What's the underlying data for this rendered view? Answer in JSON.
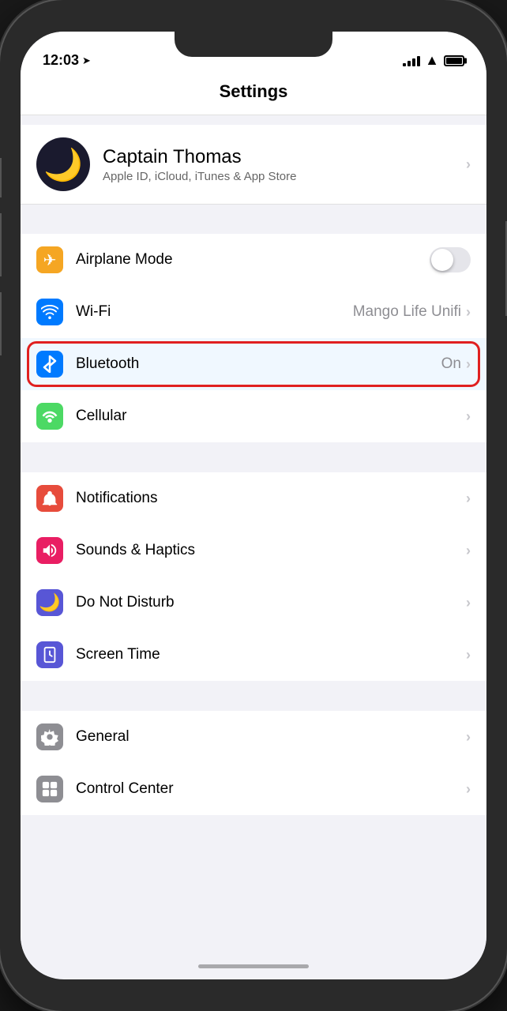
{
  "status_bar": {
    "time": "12:03",
    "has_location": true,
    "signal_bars": [
      3,
      5,
      7,
      10,
      12
    ],
    "battery_label": "battery"
  },
  "nav": {
    "title": "Settings"
  },
  "profile": {
    "name": "Captain Thomas",
    "subtitle": "Apple ID, iCloud, iTunes & App Store",
    "avatar_emoji": "🌙"
  },
  "settings_groups": [
    {
      "id": "connectivity",
      "items": [
        {
          "id": "airplane-mode",
          "icon_bg": "#f5a623",
          "icon": "✈",
          "label": "Airplane Mode",
          "value": "",
          "has_toggle": true,
          "toggle_on": false,
          "has_chevron": false
        },
        {
          "id": "wifi",
          "icon_bg": "#007aff",
          "icon": "📶",
          "label": "Wi-Fi",
          "value": "Mango Life Unifi",
          "has_toggle": false,
          "has_chevron": true
        },
        {
          "id": "bluetooth",
          "icon_bg": "#007aff",
          "icon": "Ⓑ",
          "label": "Bluetooth",
          "value": "On",
          "has_toggle": false,
          "has_chevron": true,
          "highlighted": true
        },
        {
          "id": "cellular",
          "icon_bg": "#4cd964",
          "icon": "📡",
          "label": "Cellular",
          "value": "",
          "has_toggle": false,
          "has_chevron": true
        }
      ]
    },
    {
      "id": "notifications-group",
      "items": [
        {
          "id": "notifications",
          "icon_bg": "#e74c3c",
          "icon": "🔔",
          "label": "Notifications",
          "value": "",
          "has_toggle": false,
          "has_chevron": true
        },
        {
          "id": "sounds-haptics",
          "icon_bg": "#e91e63",
          "icon": "🔊",
          "label": "Sounds & Haptics",
          "value": "",
          "has_toggle": false,
          "has_chevron": true
        },
        {
          "id": "do-not-disturb",
          "icon_bg": "#5856d6",
          "icon": "🌙",
          "label": "Do Not Disturb",
          "value": "",
          "has_toggle": false,
          "has_chevron": true
        },
        {
          "id": "screen-time",
          "icon_bg": "#5856d6",
          "icon": "⏳",
          "label": "Screen Time",
          "value": "",
          "has_toggle": false,
          "has_chevron": true
        }
      ]
    },
    {
      "id": "general-group",
      "items": [
        {
          "id": "general",
          "icon_bg": "#8e8e93",
          "icon": "⚙",
          "label": "General",
          "value": "",
          "has_toggle": false,
          "has_chevron": true
        },
        {
          "id": "control-center",
          "icon_bg": "#8e8e93",
          "icon": "🎛",
          "label": "Control Center",
          "value": "",
          "has_toggle": false,
          "has_chevron": true
        }
      ]
    }
  ]
}
